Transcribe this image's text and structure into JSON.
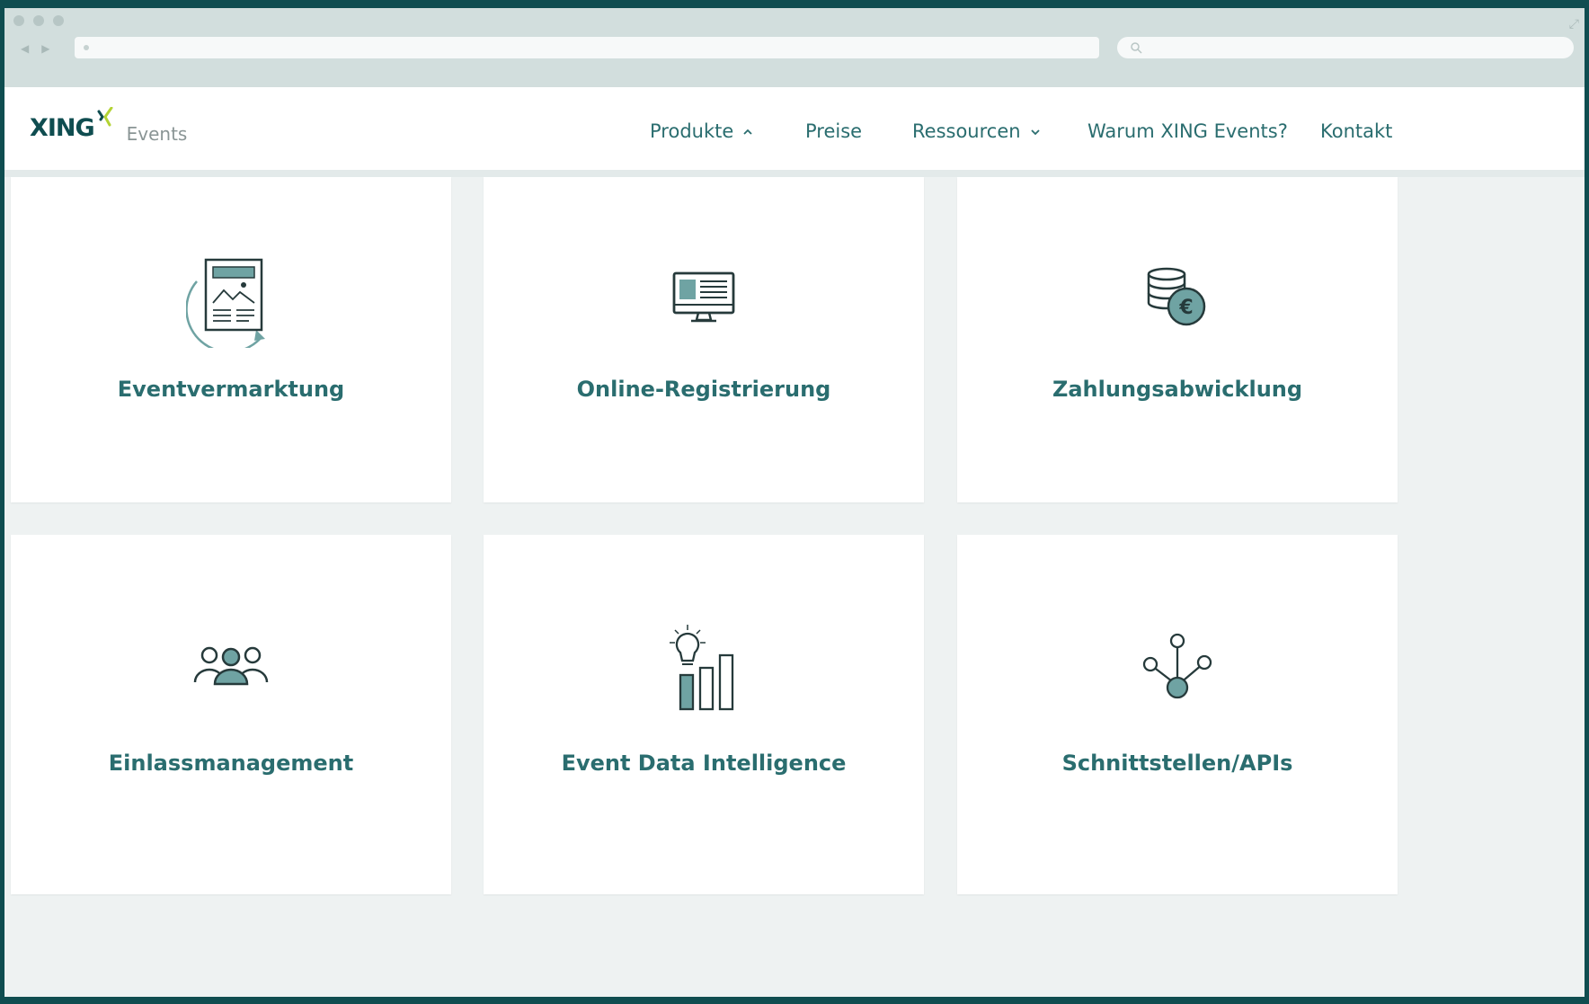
{
  "header": {
    "logo_text": "XING",
    "logo_sub": "Events",
    "nav": [
      {
        "label": "Produkte"
      },
      {
        "label": "Preise"
      },
      {
        "label": "Ressourcen"
      },
      {
        "label": "Warum XING Events?"
      },
      {
        "label": "Kontakt"
      }
    ]
  },
  "cards": [
    {
      "label": "Eventvermarktung",
      "icon": "newsletter-icon"
    },
    {
      "label": "Online-Registrierung",
      "icon": "monitor-icon"
    },
    {
      "label": "Zahlungsabwicklung",
      "icon": "euro-coins-icon"
    },
    {
      "label": "Einlassmanagement",
      "icon": "people-group-icon"
    },
    {
      "label": "Event Data Intelligence",
      "icon": "lightbulb-chart-icon"
    },
    {
      "label": "Schnittstellen/APIs",
      "icon": "api-network-icon"
    }
  ],
  "colors": {
    "brand": "#0f4d50",
    "accent": "#2a6d6f",
    "icon_fill": "#6fa3a3",
    "logo_green": "#b3d334"
  }
}
